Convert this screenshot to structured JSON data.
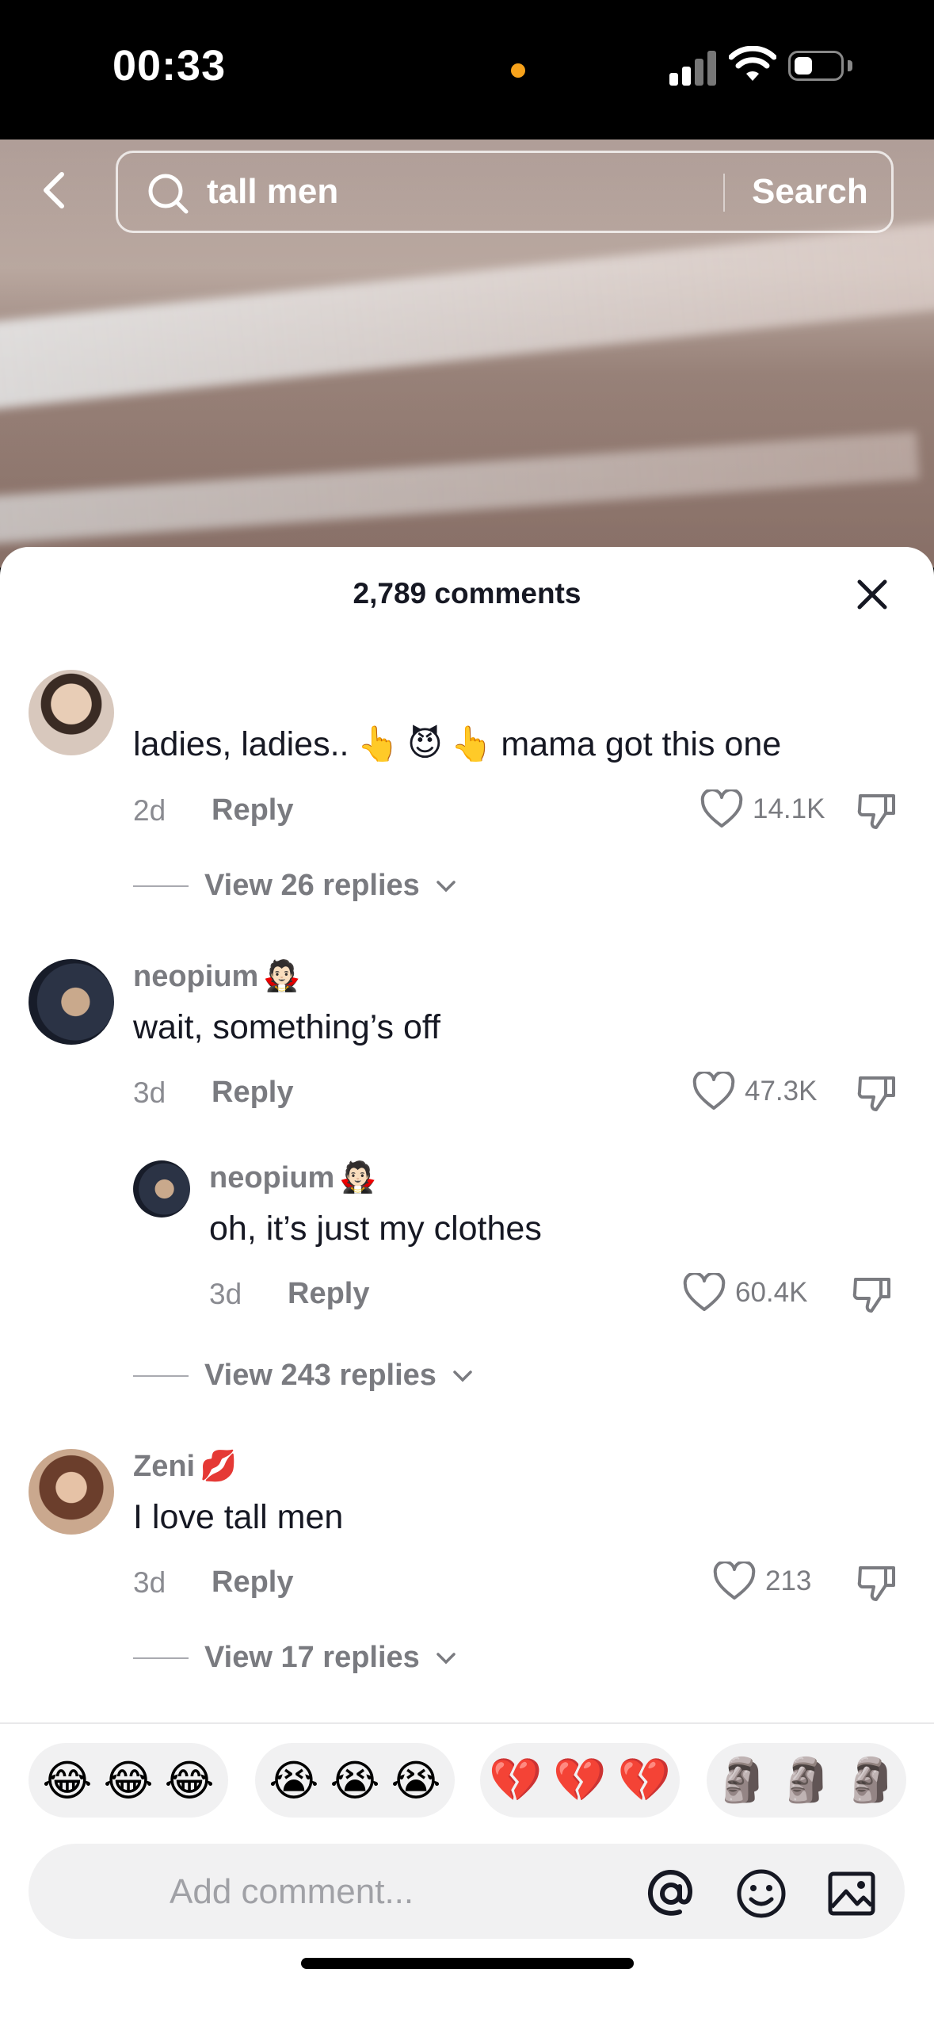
{
  "status_bar": {
    "time": "00:33"
  },
  "search": {
    "query": "tall men",
    "button_label": "Search"
  },
  "sheet": {
    "title": "2,789 comments"
  },
  "comments": [
    {
      "username": "",
      "text_before": "ladies, ladies..",
      "emojis_mid": [
        "👆",
        "😈",
        "👆"
      ],
      "text_after": "mama got this one",
      "age": "2d",
      "reply_label": "Reply",
      "likes": "14.1K",
      "view_replies": "View 26 replies"
    },
    {
      "username": "neopium",
      "username_emoji": "🧛🏻",
      "text": "wait, something’s off",
      "age": "3d",
      "reply_label": "Reply",
      "likes": "47.3K"
    },
    {
      "username": "neopium",
      "username_emoji": "🧛🏻",
      "text": "oh, it’s just my clothes",
      "age": "3d",
      "reply_label": "Reply",
      "likes": "60.4K",
      "view_replies": "View 243 replies"
    },
    {
      "username": "Zeni",
      "username_emoji": "💋",
      "text": "I love tall men",
      "age": "3d",
      "reply_label": "Reply",
      "likes": "213",
      "view_replies": "View 17 replies"
    }
  ],
  "quick_emojis": [
    [
      "😂",
      "😂",
      "😂"
    ],
    [
      "😭",
      "😭",
      "😭"
    ],
    [
      "💔",
      "💔",
      "💔"
    ],
    [
      "🗿",
      "🗿",
      "🗿"
    ]
  ],
  "input": {
    "placeholder": "Add comment..."
  },
  "icons": [
    "back-icon",
    "search-icon",
    "close-icon",
    "heart-icon",
    "dislike-icon",
    "chevron-down-icon",
    "at-icon",
    "emoji-icon",
    "image-icon"
  ]
}
